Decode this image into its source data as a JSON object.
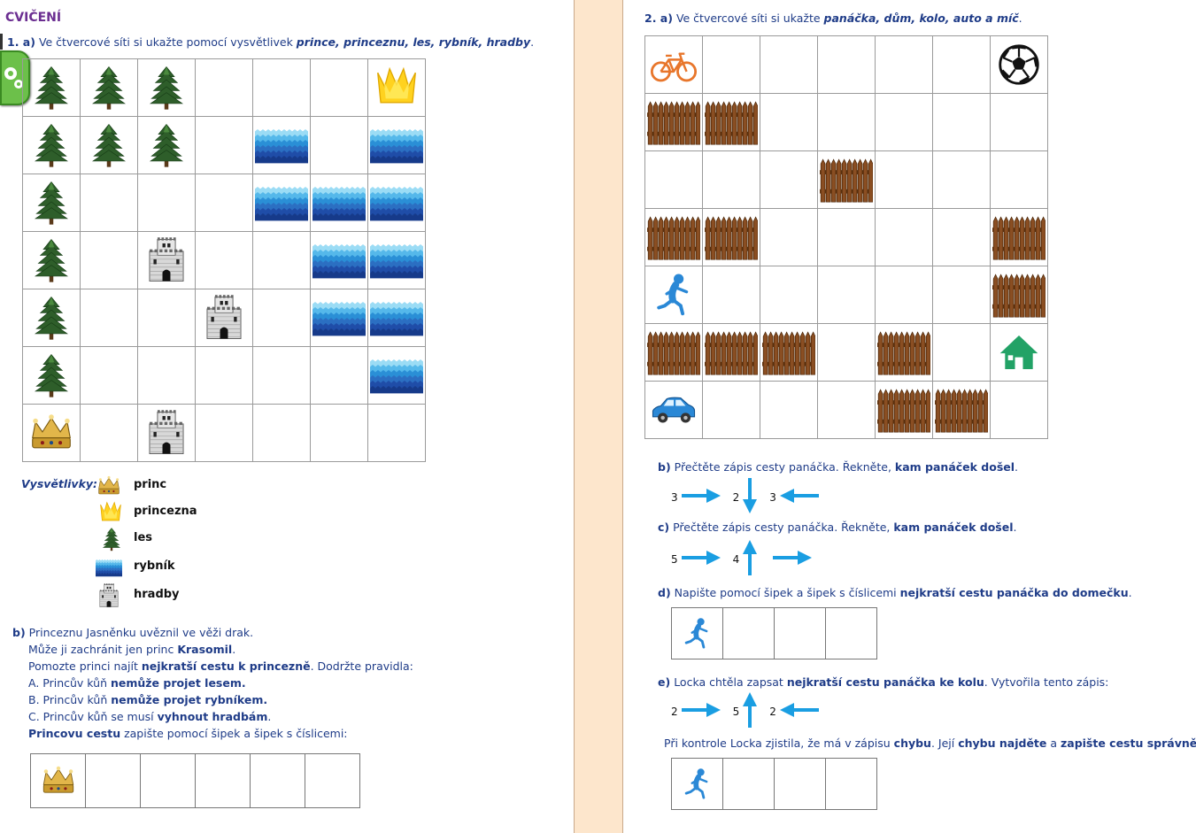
{
  "left": {
    "title": "CVIČENÍ",
    "q1a": {
      "number": "1. a)",
      "text": "Ve čtvercové síti si ukažte pomocí vysvětlivek",
      "items": "prince, princeznu, les, rybník, hradby",
      "end": "."
    },
    "grid": [
      [
        "tree",
        "tree",
        "tree",
        "",
        "",
        "",
        "crown-yellow"
      ],
      [
        "tree",
        "tree",
        "tree",
        "",
        "water",
        "",
        "water"
      ],
      [
        "tree",
        "",
        "",
        "",
        "water",
        "water",
        "water"
      ],
      [
        "tree",
        "",
        "castle",
        "",
        "",
        "water",
        "water"
      ],
      [
        "tree",
        "",
        "",
        "castle",
        "",
        "water",
        "water"
      ],
      [
        "tree",
        "",
        "",
        "",
        "",
        "",
        "water"
      ],
      [
        "crown-gold",
        "",
        "castle",
        "",
        "",
        "",
        ""
      ]
    ],
    "legend": {
      "title": "Vysvětlivky:",
      "items": [
        {
          "icon": "crown-gold",
          "label": "princ"
        },
        {
          "icon": "crown-yellow",
          "label": "princezna"
        },
        {
          "icon": "tree",
          "label": "les"
        },
        {
          "icon": "water",
          "label": "rybník"
        },
        {
          "icon": "castle",
          "label": "hradby"
        }
      ]
    },
    "q1b": {
      "number": "b)",
      "line1": "Princeznu Jasněnku uvěznil ve věži drak.",
      "line2_a": "Může ji zachránit jen princ ",
      "line2_b": "Krasomil",
      "line2_c": ".",
      "line3_a": "Pomozte princi najít ",
      "line3_b": "nejkratší cestu k princezně",
      "line3_c": ". Dodržte pravidla:",
      "rule_a_1": "A. Princův kůň ",
      "rule_a_2": "nemůže projet lesem.",
      "rule_b_1": "B. Princův kůň ",
      "rule_b_2": "nemůže projet rybníkem.",
      "rule_c_1": "C. Princův kůň se musí ",
      "rule_c_2": "vyhnout hradbám",
      "rule_c_3": ".",
      "final_1": "Princovu cestu",
      "final_2": " zapište pomocí šipek a šipek s číslicemi:"
    }
  },
  "right": {
    "q2a": {
      "number": "2. a)",
      "text": "Ve čtvercové síti si ukažte",
      "items": "panáčka, dům, kolo, auto a míč",
      "end": "."
    },
    "grid": [
      [
        "bike",
        "",
        "",
        "",
        "",
        "",
        "ball"
      ],
      [
        "fence",
        "fence",
        "",
        "",
        "",
        "",
        ""
      ],
      [
        "",
        "",
        "",
        "fence",
        "",
        "",
        ""
      ],
      [
        "fence",
        "fence",
        "",
        "",
        "",
        "",
        "fence"
      ],
      [
        "runner",
        "",
        "",
        "",
        "",
        "",
        "fence"
      ],
      [
        "fence",
        "fence",
        "fence",
        "",
        "fence",
        "",
        "house"
      ],
      [
        "car",
        "",
        "",
        "",
        "fence",
        "fence",
        ""
      ]
    ],
    "qb": {
      "label": "b)",
      "text": "Přečtěte zápis cesty panáčka. Řekněte, ",
      "bold": "kam panáček došel",
      "end": ".",
      "arrows": [
        {
          "n": "3",
          "dir": "right"
        },
        {
          "n": "2",
          "dir": "down"
        },
        {
          "n": "3",
          "dir": "left"
        }
      ]
    },
    "qc": {
      "label": "c)",
      "text": "Přečtěte zápis cesty panáčka. Řekněte, ",
      "bold": "kam panáček došel",
      "end": ".",
      "arrows": [
        {
          "n": "5",
          "dir": "right"
        },
        {
          "n": "4",
          "dir": "up"
        },
        {
          "n": "",
          "dir": "right"
        }
      ]
    },
    "qd": {
      "label": "d)",
      "text": "Napište pomocí šipek a šipek s číslicemi ",
      "bold": "nejkratší cestu panáčka do domečku",
      "end": "."
    },
    "qe": {
      "label": "e)",
      "text1": "Locka chtěla zapsat ",
      "bold": "nejkratší cestu panáčka ke kolu",
      "text2": ". Vytvořila tento zápis:",
      "arrows": [
        {
          "n": "2",
          "dir": "right"
        },
        {
          "n": "5",
          "dir": "up"
        },
        {
          "n": "2",
          "dir": "left"
        }
      ]
    },
    "check": {
      "t1": "Při kontrole Locka zjistila, že má v zápisu ",
      "b1": "chybu",
      "t2": ". Její ",
      "b2": "chybu najděte",
      "t3": " a ",
      "b3": "zapište cestu správně",
      "t4": ":"
    }
  }
}
